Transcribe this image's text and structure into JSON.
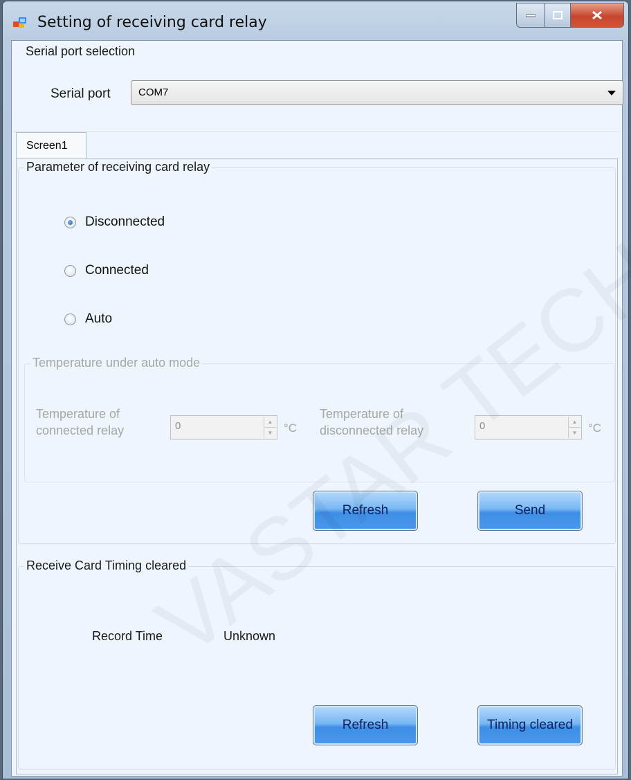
{
  "window": {
    "title": "Setting of receiving card relay"
  },
  "serial": {
    "group_label": "Serial port selection",
    "port_label": "Serial port",
    "selected_port": "COM7"
  },
  "tabs": [
    {
      "label": "Screen1"
    }
  ],
  "relay": {
    "group_label": "Parameter of receiving card relay",
    "options": [
      "Disconnected",
      "Connected",
      "Auto"
    ],
    "selected": "Disconnected",
    "auto": {
      "group_label": "Temperature under auto mode",
      "connected_label_line1": "Temperature of",
      "connected_label_line2": "connected relay",
      "connected_value": "0",
      "disconnected_label_line1": "Temperature of",
      "disconnected_label_line2": "disconnected relay",
      "disconnected_value": "0",
      "unit1": "°C",
      "unit2": "°C"
    },
    "refresh_label": "Refresh",
    "send_label": "Send"
  },
  "timing": {
    "group_label": "Receive Card Timing cleared",
    "record_time_label": "Record Time",
    "record_time_value": "Unknown",
    "refresh_label": "Refresh",
    "timing_cleared_label": "Timing cleared"
  },
  "watermark": "VASTAR TECH CO.",
  "colors": {
    "button_blue": "#4a98ec",
    "client_bg": "#eef5fc",
    "close_red": "#c7462c"
  }
}
